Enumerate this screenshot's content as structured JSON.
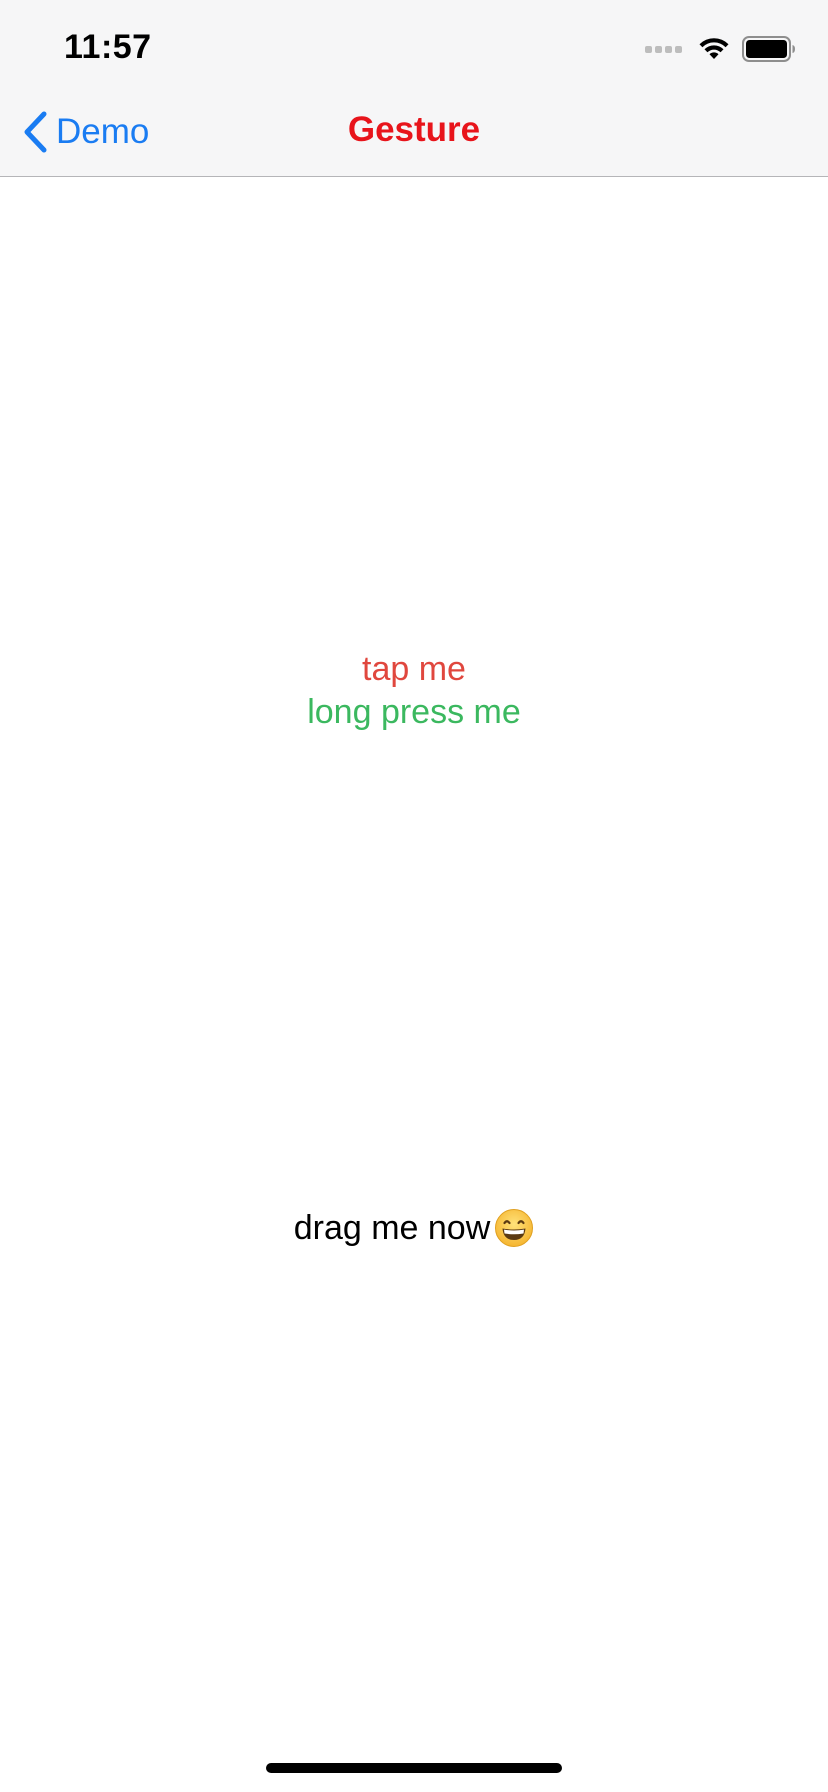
{
  "status_bar": {
    "time": "11:57",
    "icons": [
      "cellular-signal-icon",
      "wifi-icon",
      "battery-icon"
    ]
  },
  "nav_bar": {
    "back_label": "Demo",
    "title": "Gesture",
    "colors": {
      "back": "#1a7cf2",
      "title": "#e8141b"
    }
  },
  "content": {
    "tap_label": "tap me",
    "long_press_label": "long press me",
    "drag_label": "drag me now",
    "drag_emoji": "grinning-face-emoji",
    "colors": {
      "tap": "#e0473e",
      "long_press": "#3bb85f",
      "drag": "#000000"
    }
  }
}
